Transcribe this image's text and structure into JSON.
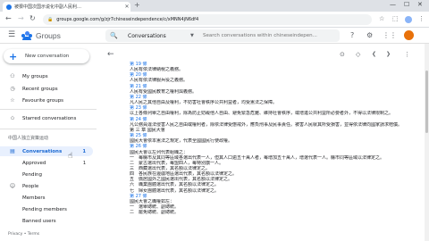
{
  "browser": {
    "tab_title": "被狠中国次国示说化中副人民利…",
    "url": "groups.google.com/g/zjr7chineseindependence/c/xMNN4jN6df4"
  },
  "header": {
    "product": "Groups",
    "search_scope": "Conversations",
    "search_placeholder": "Search conversations within chineseindepen..."
  },
  "sidebar": {
    "new_conversation": "New conversation",
    "top_items": [
      {
        "label": "My groups"
      },
      {
        "label": "Recent groups"
      },
      {
        "label": "Favourite groups"
      }
    ],
    "starred": "Starred conversations",
    "group_name": "中国人独立資策运动",
    "conversations": {
      "label": "Conversations",
      "count": "1"
    },
    "approved": {
      "label": "Approved",
      "count": "1"
    },
    "pending": {
      "label": "Pending"
    },
    "people": {
      "label": "People"
    },
    "members": {
      "label": "Members"
    },
    "pending_members": {
      "label": "Pending members"
    },
    "banned_users": {
      "label": "Banned users"
    },
    "footer": "Privacy • Terms"
  },
  "main": {
    "lines": [
      {
        "text": "第 19 條",
        "type": "article"
      },
      {
        "text": "人民有依法律納稅之義務。",
        "type": "text"
      },
      {
        "text": "第 20 條",
        "type": "article"
      },
      {
        "text": "人民有依法律服兵役之義務。",
        "type": "text"
      },
      {
        "text": "第 21 條",
        "type": "article"
      },
      {
        "text": "人民有受國民教育之權利與義務。",
        "type": "text"
      },
      {
        "text": "第 22 條",
        "type": "article"
      },
      {
        "text": "凡人民之其他自由及權利，不妨害社會秩序公共利益者，均受憲法之保障。",
        "type": "text"
      },
      {
        "text": "第 23 條",
        "type": "article"
      },
      {
        "text": "以上各條列舉之自由權利，除為防止妨礙他人自由、避免緊急危難、維持社會秩序，或增進公共利益所必要者外，不得以法律限制之。",
        "type": "text"
      },
      {
        "text": "第 24 條",
        "type": "article"
      },
      {
        "text": "凡公務員違法侵害人民之自由或權利者，除依法律受懲戒外，應負刑事及民事責任。被害人民就其所受損害，並得依法律向國家請求賠償。",
        "type": "text"
      },
      {
        "text": "第 三 章 國民大會",
        "type": "text"
      },
      {
        "text": "第 25 條",
        "type": "article"
      },
      {
        "text": "國民大會依本憲法之規定，代表全國國民行使政權。",
        "type": "text"
      },
      {
        "text": "第 26 條",
        "type": "article"
      },
      {
        "text": "國民大會以左列代表組織之：",
        "type": "text"
      },
      {
        "text": "一　每縣市及其同等區域各選出代表一人，但其人口逾五十萬人者，每增加五十萬人，增選代表一人。縣市同等區域以法律定之。",
        "type": "text"
      },
      {
        "text": "二　蒙古選出代表，每盟四人，每特別旗一人。",
        "type": "text"
      },
      {
        "text": "三　西藏選出代表，其名額以法律定之。",
        "type": "text"
      },
      {
        "text": "四　各民族在邊疆地區選出代表，其名額以法律定之。",
        "type": "text"
      },
      {
        "text": "五　僑居國外之國民選出代表，其名額以法律定之。",
        "type": "text"
      },
      {
        "text": "六　職業團體選出代表，其名額以法律定之。",
        "type": "text"
      },
      {
        "text": "七　婦女團體選出代表，其名額以法律定之。",
        "type": "text"
      },
      {
        "text": "第 27 條",
        "type": "article"
      },
      {
        "text": "國民大會之職權如左：",
        "type": "text"
      },
      {
        "text": "一　選舉總統、副總統。",
        "type": "text"
      },
      {
        "text": "二　罷免總統、副總統。",
        "type": "text"
      }
    ]
  }
}
